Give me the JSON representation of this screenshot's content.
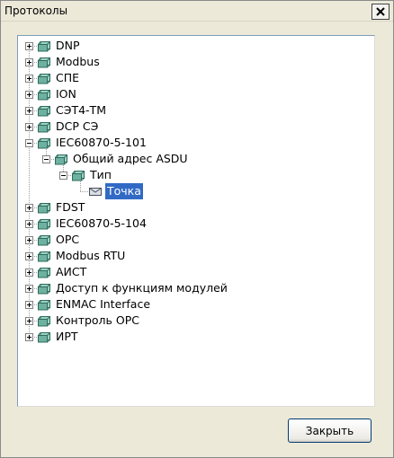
{
  "window": {
    "title": "Протоколы"
  },
  "tree": {
    "items": [
      {
        "label": "DNP",
        "level": 0,
        "expander": "plus",
        "icon": "folder-icon"
      },
      {
        "label": "Modbus",
        "level": 0,
        "expander": "plus",
        "icon": "folder-icon"
      },
      {
        "label": "СПЕ",
        "level": 0,
        "expander": "plus",
        "icon": "folder-icon"
      },
      {
        "label": "ION",
        "level": 0,
        "expander": "plus",
        "icon": "folder-icon"
      },
      {
        "label": "СЭТ4-ТМ",
        "level": 0,
        "expander": "plus",
        "icon": "folder-icon"
      },
      {
        "label": "DCP СЭ",
        "level": 0,
        "expander": "plus",
        "icon": "folder-icon"
      },
      {
        "label": "IEC60870-5-101",
        "level": 0,
        "expander": "minus",
        "icon": "folder-icon"
      },
      {
        "label": "Общий адрес ASDU",
        "level": 1,
        "expander": "minus",
        "icon": "folder-icon"
      },
      {
        "label": "Тип",
        "level": 2,
        "expander": "minus",
        "icon": "folder-icon"
      },
      {
        "label": "Точка",
        "level": 3,
        "expander": "none",
        "icon": "point-icon",
        "selected": true
      },
      {
        "label": "FDST",
        "level": 0,
        "expander": "plus",
        "icon": "folder-icon"
      },
      {
        "label": "IEC60870-5-104",
        "level": 0,
        "expander": "plus",
        "icon": "folder-icon"
      },
      {
        "label": "OPC",
        "level": 0,
        "expander": "plus",
        "icon": "folder-icon"
      },
      {
        "label": "Modbus RTU",
        "level": 0,
        "expander": "plus",
        "icon": "folder-icon"
      },
      {
        "label": "АИСТ",
        "level": 0,
        "expander": "plus",
        "icon": "folder-icon"
      },
      {
        "label": "Доступ к функциям модулей",
        "level": 0,
        "expander": "plus",
        "icon": "folder-icon"
      },
      {
        "label": "ENMAC Interface",
        "level": 0,
        "expander": "plus",
        "icon": "folder-icon"
      },
      {
        "label": "Контроль OPC",
        "level": 0,
        "expander": "plus",
        "icon": "folder-icon"
      },
      {
        "label": "ИРТ",
        "level": 0,
        "expander": "plus",
        "icon": "folder-icon"
      }
    ]
  },
  "footer": {
    "close_label": "Закрыть"
  },
  "colors": {
    "selection": "#316ac5",
    "folder_fill": "#6fb1a0",
    "folder_stroke": "#2d6b5d",
    "tree_lines": "#a0a0a0"
  }
}
